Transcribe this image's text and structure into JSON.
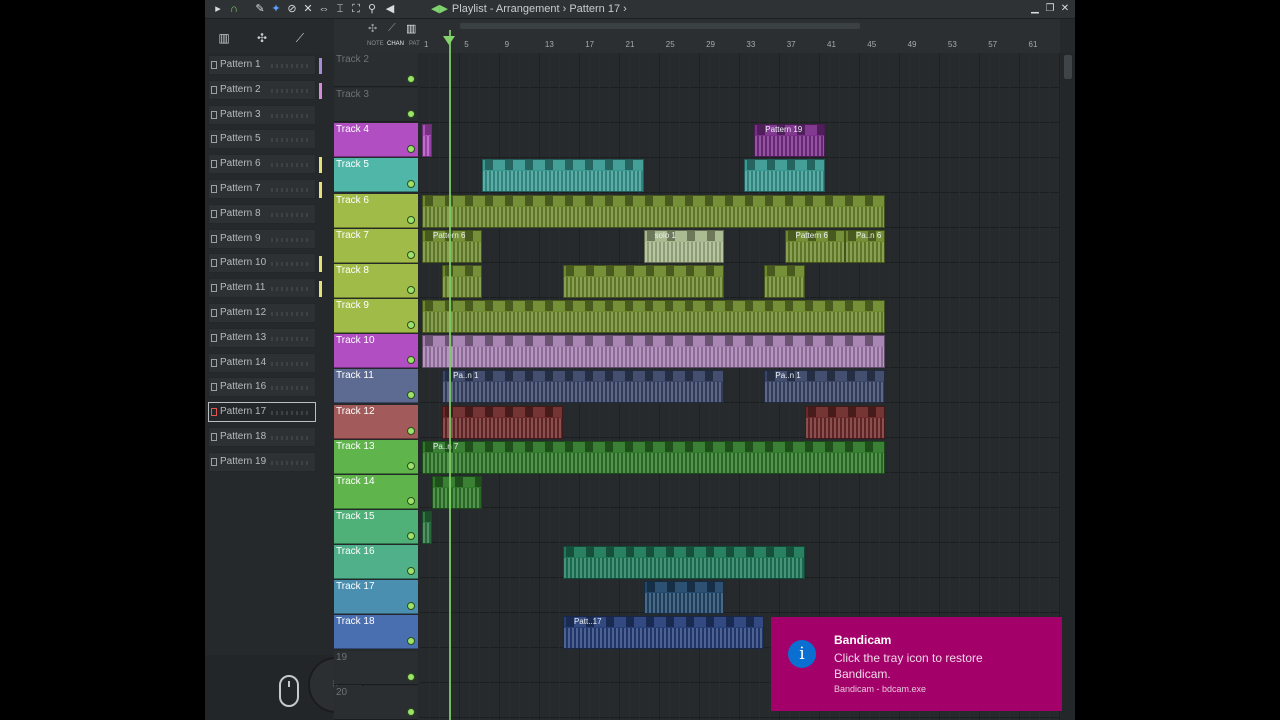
{
  "window": {
    "title_prefix": "Playlist - Arrangement",
    "sep": "›",
    "pattern": "Pattern 17",
    "title_suffix": "›"
  },
  "toolbar": {
    "icons": [
      "play-arrow-icon",
      "magnet-icon",
      "pencil-icon",
      "paint-icon",
      "delete-icon",
      "mute-icon",
      "slip-icon",
      "slice-icon",
      "select-icon",
      "zoom-icon",
      "playback-icon"
    ]
  },
  "header_tabs": {
    "note": "NOTE",
    "chan": "CHAN",
    "pat": "PAT"
  },
  "browser": {
    "patterns": [
      {
        "label": "Pattern 1",
        "color": "#a78cd6"
      },
      {
        "label": "Pattern 2",
        "color": "#d58cd6"
      },
      {
        "label": "Pattern 3",
        "color": ""
      },
      {
        "label": "Pattern 5",
        "color": ""
      },
      {
        "label": "Pattern 6",
        "color": "#e5e07a"
      },
      {
        "label": "Pattern 7",
        "color": "#e5e07a"
      },
      {
        "label": "Pattern 8",
        "color": ""
      },
      {
        "label": "Pattern 9",
        "color": ""
      },
      {
        "label": "Pattern 10",
        "color": "#e5e07a"
      },
      {
        "label": "Pattern 11",
        "color": "#e5e07a"
      },
      {
        "label": "Pattern 12",
        "color": ""
      },
      {
        "label": "Pattern 13",
        "color": ""
      },
      {
        "label": "Pattern 14",
        "color": ""
      },
      {
        "label": "Pattern 16",
        "color": ""
      },
      {
        "label": "Pattern 17",
        "color": ""
      },
      {
        "label": "Pattern 18",
        "color": ""
      },
      {
        "label": "Pattern 19",
        "color": ""
      }
    ],
    "selected": "Pattern 17"
  },
  "ruler": {
    "labels": [
      "1",
      "5",
      "9",
      "13",
      "17",
      "21",
      "25",
      "29",
      "33",
      "37",
      "41",
      "45",
      "49",
      "53",
      "57",
      "61"
    ]
  },
  "tracks": [
    {
      "label": "Track 2",
      "color": "",
      "empty": true
    },
    {
      "label": "Track 3",
      "color": "",
      "empty": true
    },
    {
      "label": "Track 4",
      "color": "#b04ec2"
    },
    {
      "label": "Track 5",
      "color": "#4fb6a8"
    },
    {
      "label": "Track 6",
      "color": "#a1bb48"
    },
    {
      "label": "Track 7",
      "color": "#a1bb48"
    },
    {
      "label": "Track 8",
      "color": "#a1bb48"
    },
    {
      "label": "Track 9",
      "color": "#a1bb48"
    },
    {
      "label": "Track 10",
      "color": "#b04ec2"
    },
    {
      "label": "Track 11",
      "color": "#5d6a92"
    },
    {
      "label": "Track 12",
      "color": "#a25a5a"
    },
    {
      "label": "Track 13",
      "color": "#5fb54b"
    },
    {
      "label": "Track 14",
      "color": "#5fb54b"
    },
    {
      "label": "Track 15",
      "color": "#4fb078"
    },
    {
      "label": "Track 16",
      "color": "#4fb08a"
    },
    {
      "label": "Track 17",
      "color": "#4a8fb0"
    },
    {
      "label": "Track 18",
      "color": "#4a6fb0"
    },
    {
      "label": "19",
      "color": "",
      "empty": true
    },
    {
      "label": "20",
      "color": "",
      "empty": true
    }
  ],
  "clips": [
    {
      "track": 2,
      "from": 1,
      "to": 2,
      "color": "#b04ec2",
      "label": ""
    },
    {
      "track": 2,
      "from": 34,
      "to": 41,
      "color": "#7a2f8a",
      "label": "Pattern 19"
    },
    {
      "track": 3,
      "from": 7,
      "to": 23,
      "color": "#3a9a93",
      "label": ""
    },
    {
      "track": 3,
      "from": 33,
      "to": 41,
      "color": "#3a9a93",
      "label": ""
    },
    {
      "track": 4,
      "from": 1,
      "to": 47,
      "color": "#6f8a2e",
      "label": ""
    },
    {
      "track": 5,
      "from": 1,
      "to": 7,
      "color": "#6f8a2e",
      "label": "Pattern 6"
    },
    {
      "track": 5,
      "from": 23,
      "to": 31,
      "color": "#a8b88c",
      "label": "solo 1"
    },
    {
      "track": 5,
      "from": 37,
      "to": 43,
      "color": "#6f8a2e",
      "label": "Pattern 6"
    },
    {
      "track": 5,
      "from": 43,
      "to": 47,
      "color": "#6f8a2e",
      "label": "Pa..n 6"
    },
    {
      "track": 6,
      "from": 3,
      "to": 7,
      "color": "#6f8a2e",
      "label": ""
    },
    {
      "track": 6,
      "from": 15,
      "to": 31,
      "color": "#6f8a2e",
      "label": ""
    },
    {
      "track": 6,
      "from": 35,
      "to": 39,
      "color": "#6f8a2e",
      "label": ""
    },
    {
      "track": 7,
      "from": 1,
      "to": 47,
      "color": "#6f8a2e",
      "label": ""
    },
    {
      "track": 8,
      "from": 1,
      "to": 47,
      "color": "#a47fb0",
      "label": ""
    },
    {
      "track": 9,
      "from": 3,
      "to": 31,
      "color": "#3a4668",
      "label": "Pa..n 1"
    },
    {
      "track": 9,
      "from": 35,
      "to": 47,
      "color": "#3a4668",
      "label": "Pa..n 1"
    },
    {
      "track": 10,
      "from": 3,
      "to": 15,
      "color": "#6e2a2a",
      "label": ""
    },
    {
      "track": 10,
      "from": 39,
      "to": 47,
      "color": "#6e2a2a",
      "label": ""
    },
    {
      "track": 11,
      "from": 1,
      "to": 47,
      "color": "#2f7a2a",
      "label": "Pa..n 7"
    },
    {
      "track": 12,
      "from": 2,
      "to": 7,
      "color": "#2f7a2a",
      "label": ""
    },
    {
      "track": 13,
      "from": 1,
      "to": 2,
      "color": "#2f7a45",
      "label": ""
    },
    {
      "track": 14,
      "from": 15,
      "to": 39,
      "color": "#1f7a5a",
      "label": ""
    },
    {
      "track": 15,
      "from": 23,
      "to": 31,
      "color": "#22486b",
      "label": ""
    },
    {
      "track": 16,
      "from": 15,
      "to": 35,
      "color": "#27407a",
      "label": "Patt..17"
    }
  ],
  "toast": {
    "title": "Bandicam",
    "body": "Click the tray icon to restore Bandicam.",
    "footer": "Bandicam - bdcam.exe",
    "icon": "info-icon"
  }
}
